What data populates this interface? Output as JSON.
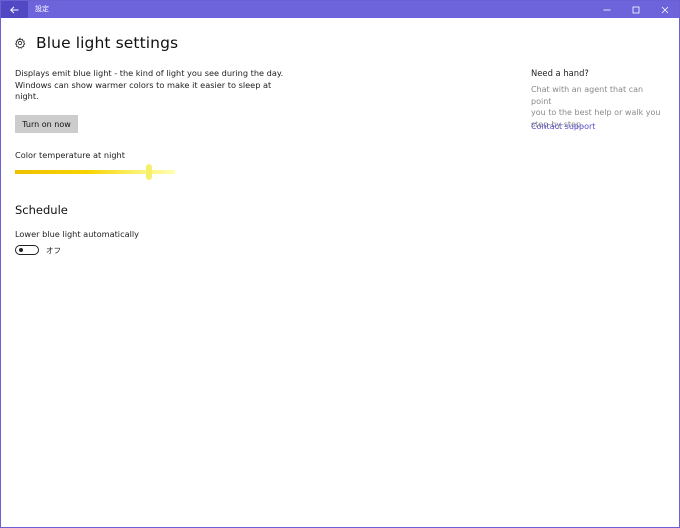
{
  "titlebar": {
    "app_title": "設定",
    "back_icon": "back-arrow-icon",
    "minimize_icon": "minimize-icon",
    "maximize_icon": "maximize-icon",
    "close_icon": "close-icon"
  },
  "header": {
    "icon": "gear-icon",
    "title": "Blue light settings"
  },
  "description": "Displays emit blue light - the kind of light you see during the day.\nWindows can show warmer colors to make it easier to sleep at\nnight.",
  "turn_on_button": {
    "label": "Turn on now"
  },
  "color_temperature": {
    "label": "Color temperature at night",
    "value_fraction": 0.84
  },
  "schedule": {
    "heading": "Schedule",
    "auto_label": "Lower blue light automatically",
    "toggle_state": "オフ",
    "toggle_on": false
  },
  "help": {
    "title": "Need a hand?",
    "text": "Chat with an agent that can point\nyou to the best help or walk you\nstep-by-step.",
    "link": "Contact support"
  },
  "colors": {
    "accent": "#6d64dc",
    "link": "#5a4fcf",
    "button_bg": "#cccccc"
  }
}
